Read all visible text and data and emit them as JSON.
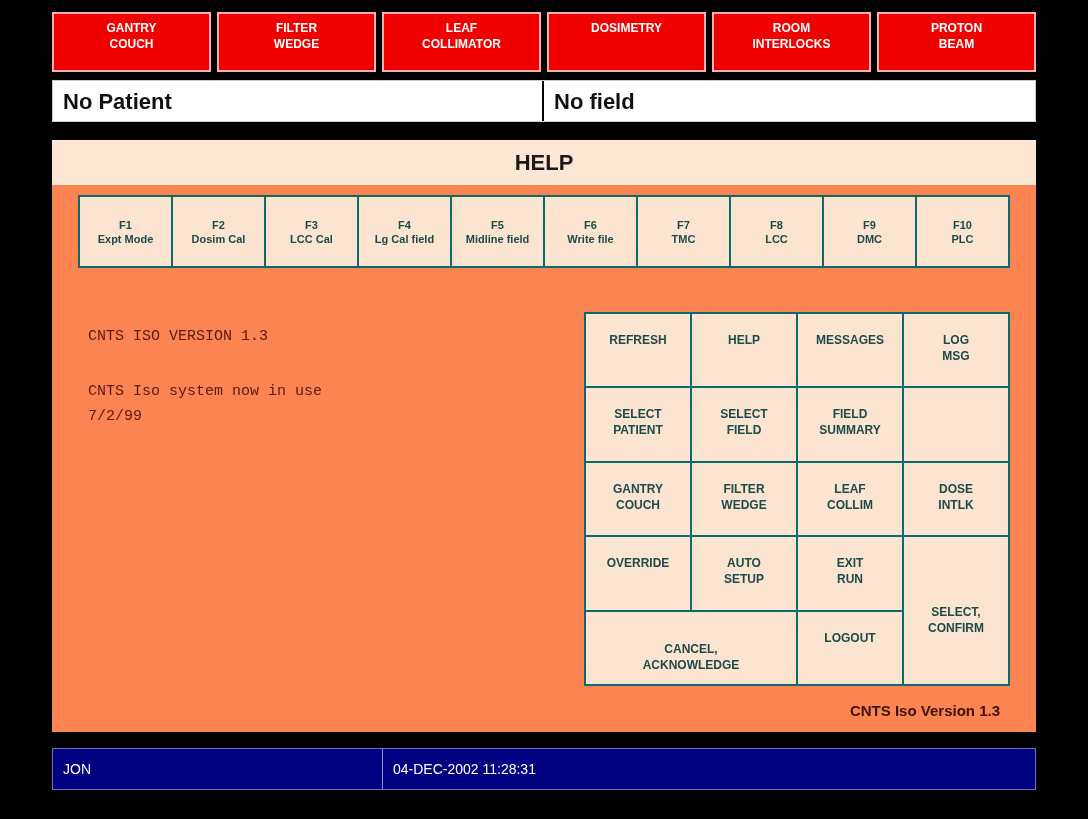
{
  "top_buttons": [
    "GANTRY\nCOUCH",
    "FILTER\nWEDGE",
    "LEAF\nCOLLIMATOR",
    "DOSIMETRY",
    "ROOM\nINTERLOCKS",
    "PROTON\nBEAM"
  ],
  "patient_bar": {
    "patient": "No Patient",
    "field": "No field"
  },
  "panel": {
    "title": "HELP",
    "function_keys": [
      {
        "key": "F1",
        "label": "Expt Mode"
      },
      {
        "key": "F2",
        "label": "Dosim Cal"
      },
      {
        "key": "F3",
        "label": "LCC Cal"
      },
      {
        "key": "F4",
        "label": "Lg Cal field"
      },
      {
        "key": "F5",
        "label": "Midline field"
      },
      {
        "key": "F6",
        "label": "Write file"
      },
      {
        "key": "F7",
        "label": "TMC"
      },
      {
        "key": "F8",
        "label": "LCC"
      },
      {
        "key": "F9",
        "label": "DMC"
      },
      {
        "key": "F10",
        "label": "PLC"
      }
    ],
    "messages": [
      "CNTS ISO VERSION 1.3",
      "CNTS Iso system now in use\n7/2/99"
    ],
    "buttons": [
      {
        "kind": "normal",
        "label": "REFRESH"
      },
      {
        "kind": "normal",
        "label": "HELP"
      },
      {
        "kind": "normal",
        "label": "MESSAGES"
      },
      {
        "kind": "normal",
        "label": "LOG\nMSG"
      },
      {
        "kind": "normal",
        "label": "SELECT\nPATIENT"
      },
      {
        "kind": "normal",
        "label": "SELECT\nFIELD"
      },
      {
        "kind": "normal",
        "label": "FIELD\nSUMMARY"
      },
      {
        "kind": "blank"
      },
      {
        "kind": "normal",
        "label": "GANTRY\nCOUCH"
      },
      {
        "kind": "normal",
        "label": "FILTER\nWEDGE"
      },
      {
        "kind": "normal",
        "label": "LEAF\nCOLLIM"
      },
      {
        "kind": "normal",
        "label": "DOSE\nINTLK"
      },
      {
        "kind": "normal",
        "label": "OVERRIDE"
      },
      {
        "kind": "normal",
        "label": "AUTO\nSETUP"
      },
      {
        "kind": "normal",
        "label": "EXIT\nRUN"
      },
      {
        "kind": "tall",
        "label": "SELECT,\nCONFIRM"
      },
      {
        "kind": "wide",
        "label": "CANCEL,\nACKNOWLEDGE"
      },
      {
        "kind": "normal",
        "label": "LOGOUT"
      }
    ],
    "version": "CNTS Iso Version 1.3"
  },
  "status_bar": {
    "user": "JON",
    "datetime": "04-DEC-2002 11:28:31"
  }
}
